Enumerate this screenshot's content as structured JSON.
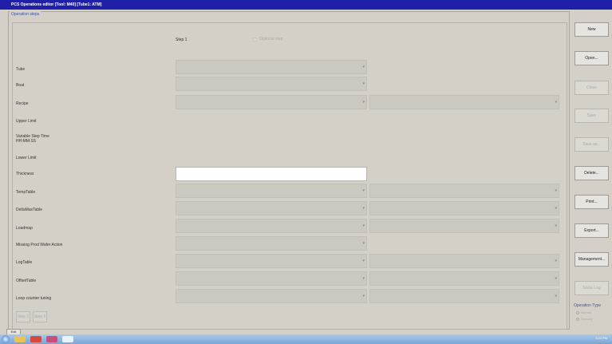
{
  "window": {
    "title": "PCS Operations editor [Tool: M40] [Tube1: ATM]"
  },
  "group": {
    "label": "Operation steps"
  },
  "step": {
    "title": "Step 1",
    "optional_label": "Optional step"
  },
  "rows": [
    {
      "label": "Tube"
    },
    {
      "label": "Boat"
    },
    {
      "label": "Recipe"
    },
    {
      "label": "Upper Limit"
    },
    {
      "label": "Variable Step Time\nHH:MM:SS"
    },
    {
      "label": "Lower Limit"
    },
    {
      "label": "Thickness"
    },
    {
      "label": "TempTable"
    },
    {
      "label": "DeltaMaxTable"
    },
    {
      "label": "Loadmap"
    },
    {
      "label": "Missing Prod Wafer Action"
    },
    {
      "label": "LogTable"
    },
    {
      "label": "OffsetTable"
    },
    {
      "label": "Loop counter tuning"
    }
  ],
  "buttons": [
    {
      "label": "New",
      "enabled": true
    },
    {
      "label": "Open...",
      "enabled": true
    },
    {
      "label": "Close",
      "enabled": false
    },
    {
      "label": "Save",
      "enabled": false
    },
    {
      "label": "Save as...",
      "enabled": false
    },
    {
      "label": "Delete...",
      "enabled": true
    },
    {
      "label": "Print...",
      "enabled": true
    },
    {
      "label": "Export...",
      "enabled": true
    },
    {
      "label": "Management...",
      "enabled": true
    },
    {
      "label": "Show Log",
      "enabled": false
    }
  ],
  "step_nav": {
    "prev": "Step 1",
    "next": "Step 1"
  },
  "operation_type": {
    "label": "Operation Type",
    "options": [
      "Normal",
      "Standby"
    ]
  },
  "quit_label": "Exit",
  "taskbar": {
    "clock": "3:20 PM"
  }
}
